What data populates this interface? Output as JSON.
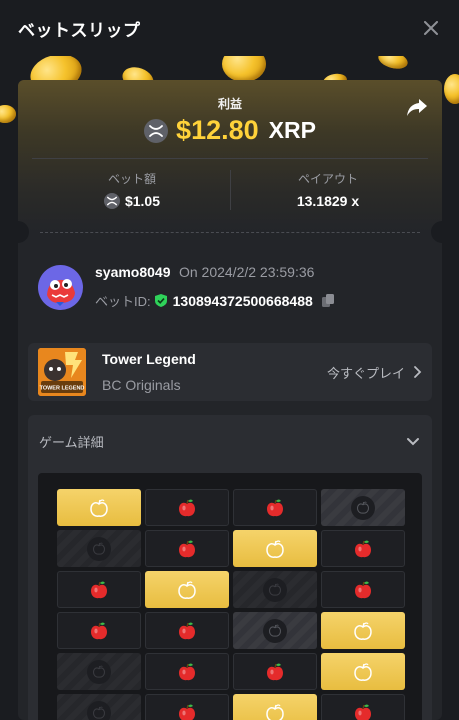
{
  "header": {
    "title": "ベットスリップ"
  },
  "result": {
    "label": "利益",
    "amount": "$12.80",
    "currency": "XRP"
  },
  "stats": {
    "bet_label": "ベット額",
    "bet_value": "$1.05",
    "payout_label": "ペイアウト",
    "payout_value": "13.1829 x"
  },
  "user": {
    "name": "syamo8049",
    "date": "On 2024/2/2 23:59:36",
    "bet_id_label": "ベットID:",
    "bet_id": "130894372500668488"
  },
  "game": {
    "name": "Tower Legend",
    "provider": "BC Originals",
    "play_label": "今すぐプレイ",
    "thumb_text": "TOWER LEGEND"
  },
  "details": {
    "title": "ゲーム詳細"
  },
  "board": {
    "rows": [
      [
        "gold",
        "apple",
        "apple",
        "dark"
      ],
      [
        "dark-dim",
        "apple",
        "gold",
        "apple"
      ],
      [
        "apple",
        "gold",
        "dark-dim",
        "apple"
      ],
      [
        "apple",
        "apple",
        "dark",
        "gold"
      ],
      [
        "dark-dim",
        "apple",
        "apple",
        "gold"
      ],
      [
        "dark-dim",
        "apple",
        "gold",
        "apple"
      ]
    ]
  },
  "colors": {
    "accent_gold": "#ffd23a",
    "bg": "#1a1c20",
    "card": "#232529",
    "verified": "#2fd35a"
  }
}
